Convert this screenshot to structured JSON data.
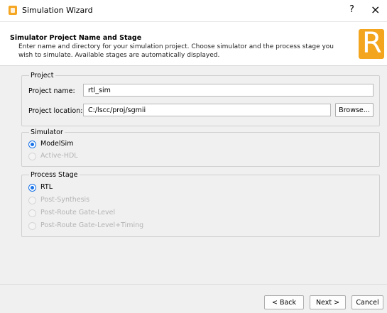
{
  "window": {
    "title": "Simulation Wizard",
    "help_label": "?",
    "close_label": "×"
  },
  "header": {
    "title": "Simulator Project Name and Stage",
    "description": "Enter name and directory for your simulation project. Choose simulator and the process stage you wish to simulate. Available stages are automatically displayed.",
    "logo_letter": "R",
    "logo_color": "#f3a51d"
  },
  "project": {
    "group_title": "Project",
    "name_label": "Project name:",
    "name_value": "rtl_sim",
    "location_label": "Project location:",
    "location_value": "C:/lscc/proj/sgmii",
    "browse_label": "Browse..."
  },
  "simulator": {
    "group_title": "Simulator",
    "options": [
      {
        "label": "ModelSim",
        "checked": true,
        "enabled": true
      },
      {
        "label": "Active-HDL",
        "checked": false,
        "enabled": false
      }
    ]
  },
  "process_stage": {
    "group_title": "Process Stage",
    "options": [
      {
        "label": "RTL",
        "checked": true,
        "enabled": true
      },
      {
        "label": "Post-Synthesis",
        "checked": false,
        "enabled": false
      },
      {
        "label": "Post-Route Gate-Level",
        "checked": false,
        "enabled": false
      },
      {
        "label": "Post-Route Gate-Level+Timing",
        "checked": false,
        "enabled": false
      }
    ]
  },
  "footer": {
    "back_label": "< Back",
    "next_label": "Next >",
    "cancel_label": "Cancel"
  },
  "colors": {
    "accent": "#1a73e8",
    "disabled_text": "#b4b4b4"
  }
}
